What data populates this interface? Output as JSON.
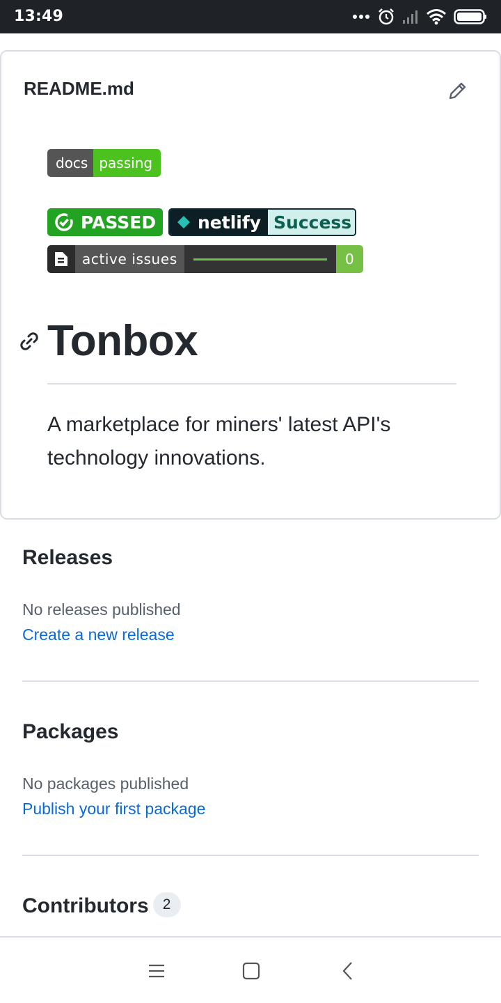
{
  "status_bar": {
    "time": "13:49"
  },
  "readme": {
    "filename": "README.md",
    "badges": {
      "docs": {
        "label": "docs",
        "value": "passing"
      },
      "passed": {
        "label": "PASSED"
      },
      "netlify": {
        "label": "netlify",
        "value": "Success"
      },
      "issues": {
        "label": "active issues",
        "value": "0"
      }
    },
    "heading": "Tonbox",
    "description": "A marketplace for miners' latest API's technology innovations."
  },
  "releases": {
    "title": "Releases",
    "empty_text": "No releases published",
    "link": "Create a new release"
  },
  "packages": {
    "title": "Packages",
    "empty_text": "No packages published",
    "link": "Publish your first package"
  },
  "contributors": {
    "title": "Contributors",
    "count": "2"
  },
  "colors": {
    "link": "#0969da",
    "badge_green": "#4cc21e",
    "passed_green": "#22a322",
    "netlify_teal": "#d1f0ec"
  }
}
